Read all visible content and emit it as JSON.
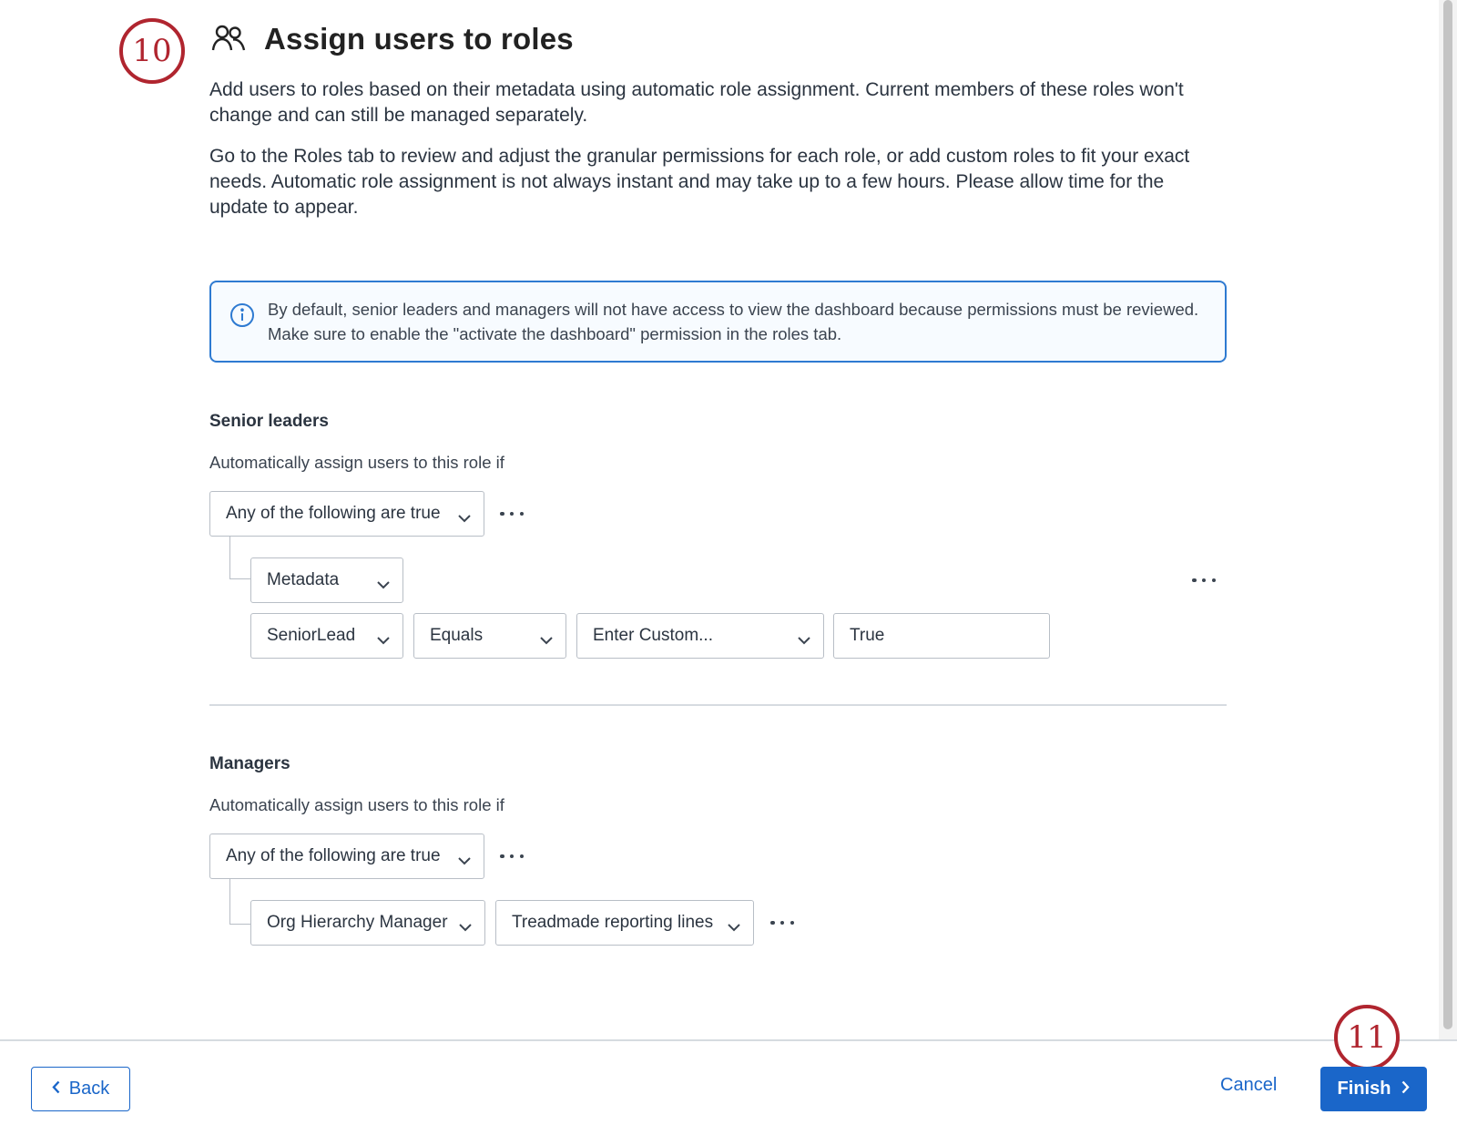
{
  "steps": {
    "first": "10",
    "second": "11"
  },
  "header": {
    "title": "Assign users to roles",
    "icon": "users-icon"
  },
  "description": {
    "p1": "Add users to roles based on their metadata using automatic role assignment. Current members of these roles won't change and can still be managed separately.",
    "p2": "Go to the Roles tab to review and adjust the granular permissions for each role, or add custom roles to fit your exact needs. Automatic role assignment is not always instant and may take up to a few hours. Please allow time for the update to appear."
  },
  "info": {
    "icon": "info-icon",
    "text": "By default, senior leaders and managers will not have access to view the dashboard because permissions must be reviewed. Make sure to enable the \"activate the dashboard\" permission in the roles tab."
  },
  "senior_leaders": {
    "title": "Senior leaders",
    "subtitle": "Automatically assign users to this role if",
    "logic": "Any of the following are true",
    "condition_type": "Metadata",
    "field": "SeniorLead",
    "operator": "Equals",
    "value_mode": "Enter Custom...",
    "value": "True"
  },
  "managers": {
    "title": "Managers",
    "subtitle": "Automatically assign users to this role if",
    "logic": "Any of the following are true",
    "condition_type": "Org Hierarchy Manager",
    "hierarchy": "Treadmade reporting lines"
  },
  "footer": {
    "back": "Back",
    "cancel": "Cancel",
    "finish": "Finish"
  },
  "colors": {
    "accent": "#1a66c9",
    "badge": "#b0252f",
    "info_border": "#2e7ad1"
  }
}
